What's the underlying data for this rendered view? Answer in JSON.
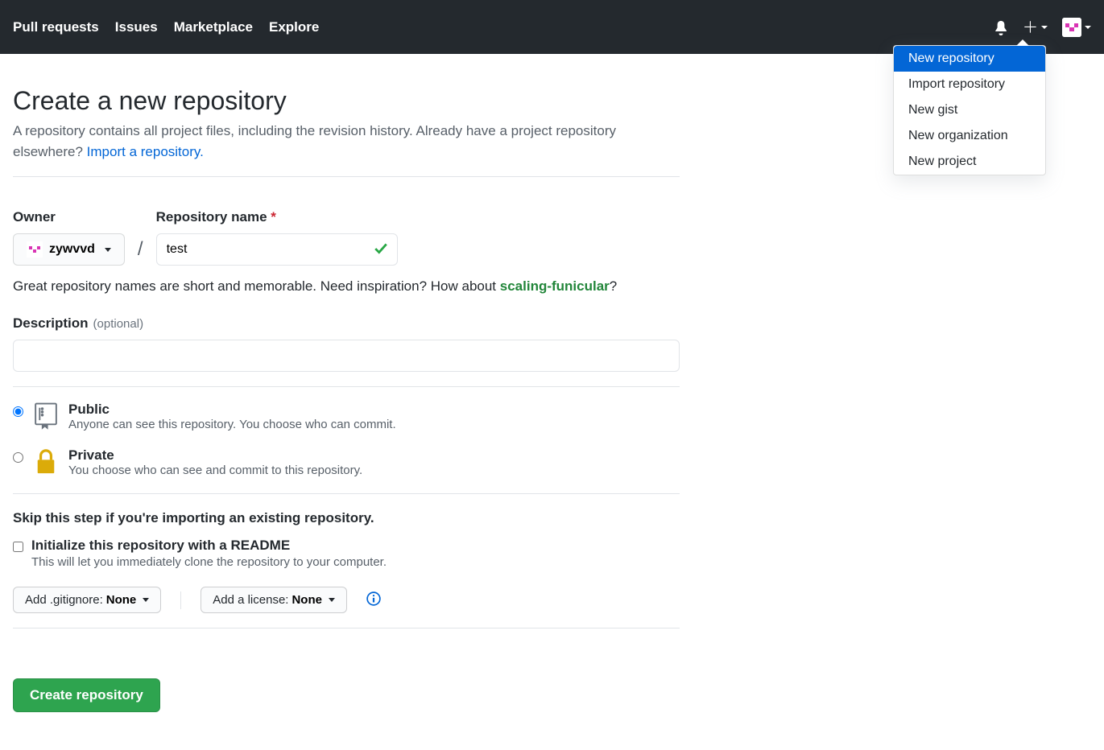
{
  "nav": {
    "pull_requests": "Pull requests",
    "issues": "Issues",
    "marketplace": "Marketplace",
    "explore": "Explore"
  },
  "dropdown": {
    "new_repository": "New repository",
    "import_repository": "Import repository",
    "new_gist": "New gist",
    "new_organization": "New organization",
    "new_project": "New project"
  },
  "page": {
    "title": "Create a new repository",
    "subhead_1": "A repository contains all project files, including the revision history. Already have a project repository elsewhere? ",
    "import_link": "Import a repository."
  },
  "form": {
    "owner_label": "Owner",
    "owner_value": "zywvvd",
    "repo_name_label": "Repository name",
    "repo_name_value": "test",
    "hint_prefix": "Great repository names are short and memorable. Need inspiration? How about ",
    "hint_suggestion": "scaling-funicular",
    "hint_suffix": "?",
    "description_label": "Description",
    "description_optional": "(optional)",
    "description_value": "",
    "visibility_public_title": "Public",
    "visibility_public_desc": "Anyone can see this repository. You choose who can commit.",
    "visibility_private_title": "Private",
    "visibility_private_desc": "You choose who can see and commit to this repository.",
    "skip_text": "Skip this step if you're importing an existing repository.",
    "readme_title": "Initialize this repository with a README",
    "readme_desc": "This will let you immediately clone the repository to your computer.",
    "gitignore_label": "Add .gitignore: ",
    "gitignore_value": "None",
    "license_label": "Add a license: ",
    "license_value": "None",
    "submit": "Create repository"
  }
}
